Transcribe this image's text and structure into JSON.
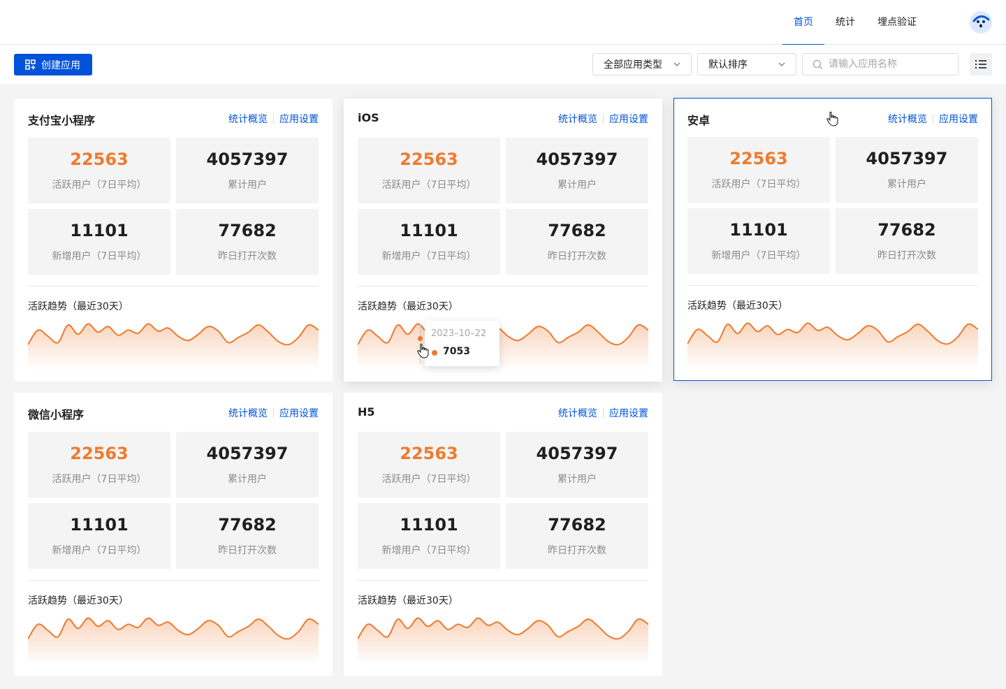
{
  "nav": {
    "items": [
      {
        "label": "首页",
        "active": true
      },
      {
        "label": "统计",
        "active": false
      },
      {
        "label": "埋点验证",
        "active": false
      }
    ]
  },
  "toolbar": {
    "create_label": "创建应用",
    "type_select": "全部应用类型",
    "sort_select": "默认排序",
    "search_placeholder": "请输入应用名称"
  },
  "colors": {
    "accent": "#0052d9",
    "orange": "#ed7b2f"
  },
  "cards": [
    {
      "title": "支付宝小程序",
      "link_overview": "统计概览",
      "link_settings": "应用设置",
      "active_users": "22563",
      "active_users_label": "活跃用户（7日平均）",
      "total_users": "4057397",
      "total_users_label": "累计用户",
      "new_users": "11101",
      "new_users_label": "新增用户（7日平均）",
      "opens": "77682",
      "opens_label": "昨日打开次数",
      "trend_label": "活跃趋势（最近30天）"
    },
    {
      "title": "iOS",
      "link_overview": "统计概览",
      "link_settings": "应用设置",
      "active_users": "22563",
      "active_users_label": "活跃用户（7日平均）",
      "total_users": "4057397",
      "total_users_label": "累计用户",
      "new_users": "11101",
      "new_users_label": "新增用户（7日平均）",
      "opens": "77682",
      "opens_label": "昨日打开次数",
      "trend_label": "活跃趋势（最近30天）",
      "tooltip": {
        "date": "2023–10–22",
        "value": "7053"
      }
    },
    {
      "title": "安卓",
      "link_overview": "统计概览",
      "link_settings": "应用设置",
      "active_users": "22563",
      "active_users_label": "活跃用户（7日平均）",
      "total_users": "4057397",
      "total_users_label": "累计用户",
      "new_users": "11101",
      "new_users_label": "新增用户（7日平均）",
      "opens": "77682",
      "opens_label": "昨日打开次数",
      "trend_label": "活跃趋势（最近30天）"
    },
    {
      "title": "微信小程序",
      "link_overview": "统计概览",
      "link_settings": "应用设置",
      "active_users": "22563",
      "active_users_label": "活跃用户（7日平均）",
      "total_users": "4057397",
      "total_users_label": "累计用户",
      "new_users": "11101",
      "new_users_label": "新增用户（7日平均）",
      "opens": "77682",
      "opens_label": "昨日打开次数",
      "trend_label": "活跃趋势（最近30天）"
    },
    {
      "title": "H5",
      "link_overview": "统计概览",
      "link_settings": "应用设置",
      "active_users": "22563",
      "active_users_label": "活跃用户（7日平均）",
      "total_users": "4057397",
      "total_users_label": "累计用户",
      "new_users": "11101",
      "new_users_label": "新增用户（7日平均）",
      "opens": "77682",
      "opens_label": "昨日打开次数",
      "trend_label": "活跃趋势（最近30天）"
    }
  ],
  "chart_data": {
    "type": "area",
    "values": [
      20,
      48,
      36,
      24,
      58,
      40,
      60,
      44,
      55,
      38,
      48,
      42,
      60,
      46,
      52,
      36,
      28,
      40,
      55,
      46,
      24,
      34,
      44,
      58,
      44,
      26,
      20,
      34,
      58,
      48
    ]
  }
}
